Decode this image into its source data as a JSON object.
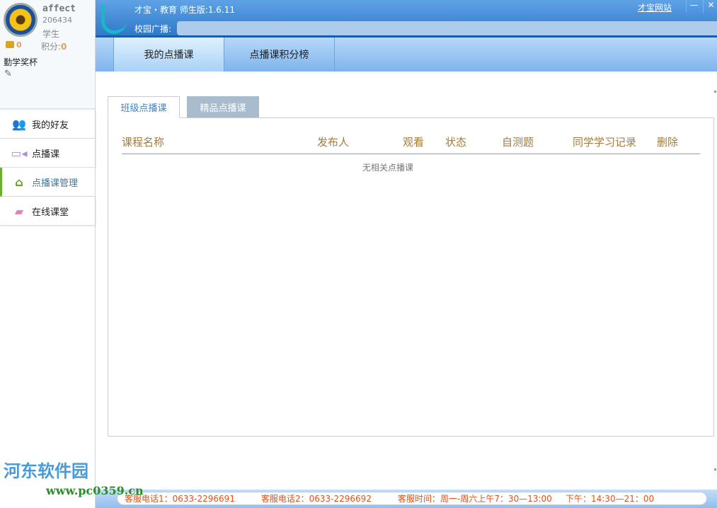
{
  "user": {
    "name": "affect",
    "id": "206434",
    "role": "学生",
    "coins": "0",
    "score_label": "积分:",
    "score": "0",
    "award": "勤学奖杯"
  },
  "sidebar": {
    "items": [
      {
        "label": "我的好友",
        "icon": "friends-icon"
      },
      {
        "label": "点播课",
        "icon": "video-icon"
      },
      {
        "label": "点播课管理",
        "icon": "manage-icon",
        "active": true
      },
      {
        "label": "在线课堂",
        "icon": "online-class-icon"
      }
    ]
  },
  "header": {
    "title": "才宝・教育 师生版:1.6.11",
    "broadcast_label": "校园广播:",
    "broadcast_value": "",
    "site_link": "才宝网站",
    "minimize": "—",
    "close": "✕"
  },
  "main_tabs": [
    {
      "label": "我的点播课",
      "active": true
    },
    {
      "label": "点播课积分榜"
    }
  ],
  "sub_tabs": [
    {
      "label": "班级点播课",
      "active": true
    },
    {
      "label": "精品点播课"
    }
  ],
  "table": {
    "columns": [
      "课程名称",
      "发布人",
      "观看",
      "状态",
      "自测题",
      "同学学习记录",
      "删除"
    ],
    "empty_text": "无相关点播课",
    "rows": []
  },
  "watermark": {
    "name": "河东软件园",
    "url": "www.pc0359.cn"
  },
  "footer": {
    "phone1": "客服电话1：0633-2296691",
    "phone2": "客服电话2：0633-2296692",
    "hours": "客服时间：周一-周六上午7：30—13:00",
    "afternoon": "下午：14:30—21：00"
  },
  "colors": {
    "header": "#2f79c9",
    "accent": "#3b86c8",
    "column_header": "#a27c40",
    "footer_text": "#e0501a",
    "active_nav": "#6bb02a"
  }
}
